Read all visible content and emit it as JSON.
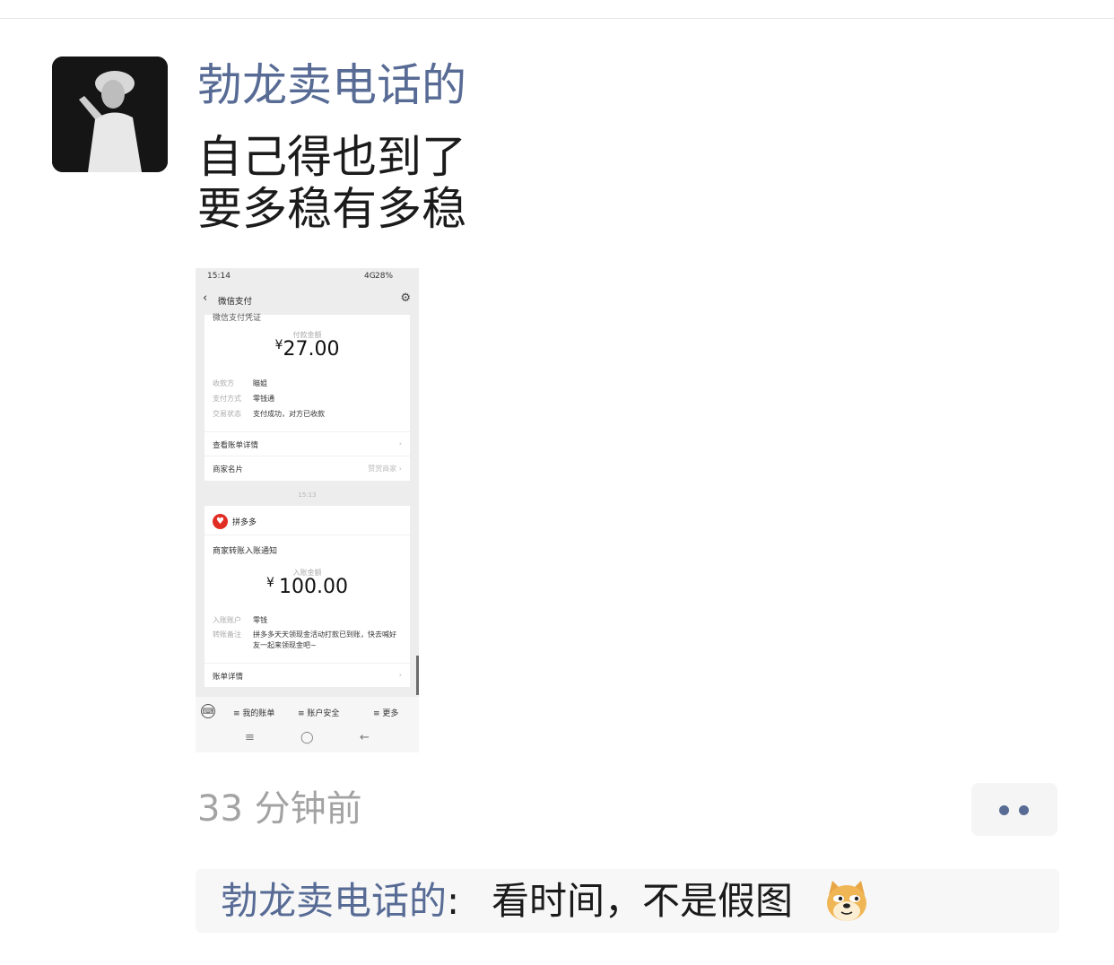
{
  "post": {
    "author": "勃龙卖电话的",
    "lines": [
      "自己得也到了",
      "要多稳有多稳"
    ],
    "time": "33 分钟前"
  },
  "screenshot": {
    "status_time": "15:14",
    "status_signal": "4G",
    "status_battery": "28%",
    "header_title": "微信支付",
    "card1": {
      "cut_text": "微信支付凭证",
      "amount_label": "付款金额",
      "currency": "¥",
      "amount": "27.00",
      "fields": [
        {
          "key": "收款方",
          "value": "瞄姐"
        },
        {
          "key": "支付方式",
          "value": "零钱通"
        },
        {
          "key": "交易状态",
          "value": "支付成功，对方已收款"
        }
      ],
      "detail_link": "查看账单详情",
      "merchant_card": "商家名片",
      "merchant_card_right": "赞赏商家"
    },
    "timestamp": "15:13",
    "card2": {
      "merchant": "拼多多",
      "title": "商家转账入账通知",
      "amount_label": "入账金额",
      "currency": "¥",
      "amount": "100.00",
      "fields": [
        {
          "key": "入账账户",
          "value": "零钱"
        },
        {
          "key": "转账备注",
          "value": "拼多多天天领现金活动打款已到账，快去喊好友一起来领现金吧~"
        }
      ],
      "detail_link": "账单详情"
    },
    "bottom_menu": [
      "≡ 我的账单",
      "≡ 账户安全",
      "≡ 更多"
    ]
  },
  "comment": {
    "author": "勃龙卖电话的",
    "separator": ":",
    "text": "看时间，不是假图"
  },
  "icons": {
    "more": "more-dots-icon",
    "emoji": "doge-emoji-icon"
  },
  "colors": {
    "link_blue": "#576b95",
    "time_gray": "#a3a3a3",
    "pdd_red": "#e02e24"
  }
}
